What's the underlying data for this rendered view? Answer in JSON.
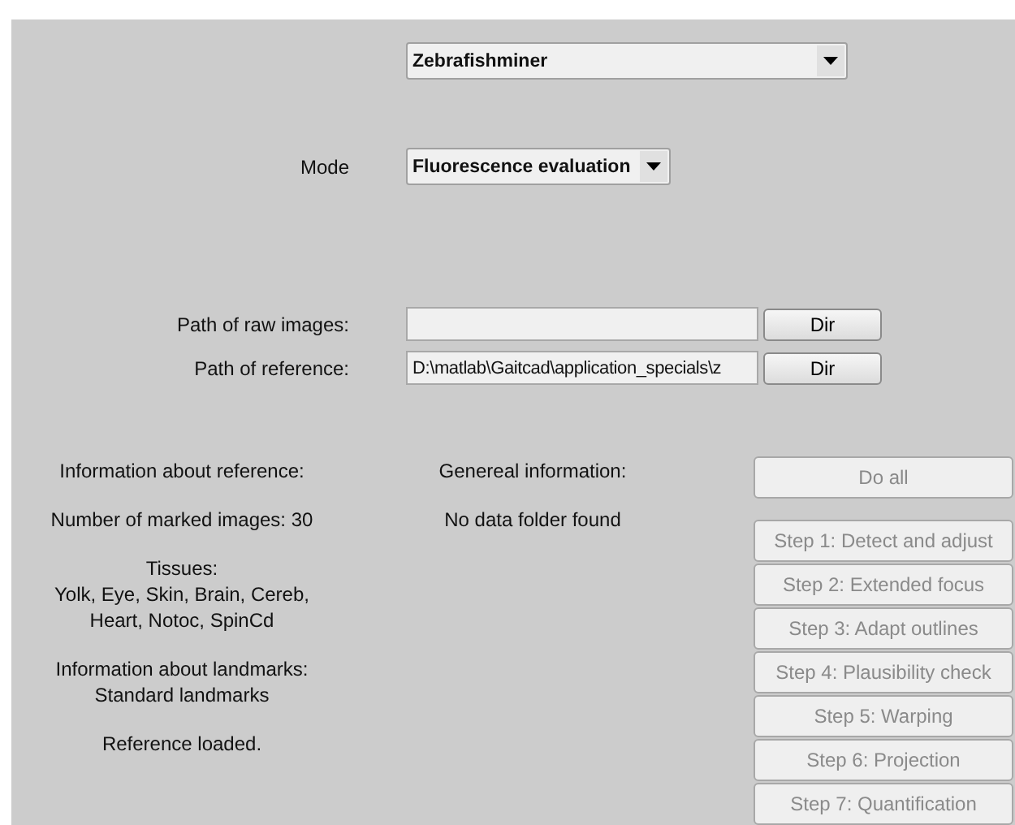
{
  "app_select": {
    "value": "Zebrafishminer"
  },
  "mode": {
    "label": "Mode",
    "value": "Fluorescence evaluation"
  },
  "paths": [
    {
      "label": "Path of raw images:",
      "button": "Dir"
    },
    {
      "label": "Path of reference:",
      "value": "D:\\matlab\\Gaitcad\\application_specials\\z",
      "button": "Dir"
    }
  ],
  "reference_info": [
    "Information about reference:",
    "Number of marked images: 30",
    "Tissues:\nYolk, Eye, Skin, Brain, Cereb,\nHeart, Notoc, SpinCd",
    "Information about landmarks:\nStandard landmarks",
    "Reference loaded."
  ],
  "general_info": [
    "Genereal information:",
    "No data folder found"
  ],
  "do_all": {
    "label": "Do all",
    "disabled": true
  },
  "steps": [
    {
      "label": "Step 1: Detect and adjust",
      "disabled": true
    },
    {
      "label": "Step 2: Extended focus",
      "disabled": true
    },
    {
      "label": "Step 3: Adapt outlines",
      "disabled": true
    },
    {
      "label": "Step 4: Plausibility check",
      "disabled": true
    },
    {
      "label": "Step 5: Warping",
      "disabled": true
    },
    {
      "label": "Step 6: Projection",
      "disabled": true
    },
    {
      "label": "Step 7: Quantification",
      "disabled": true
    }
  ]
}
